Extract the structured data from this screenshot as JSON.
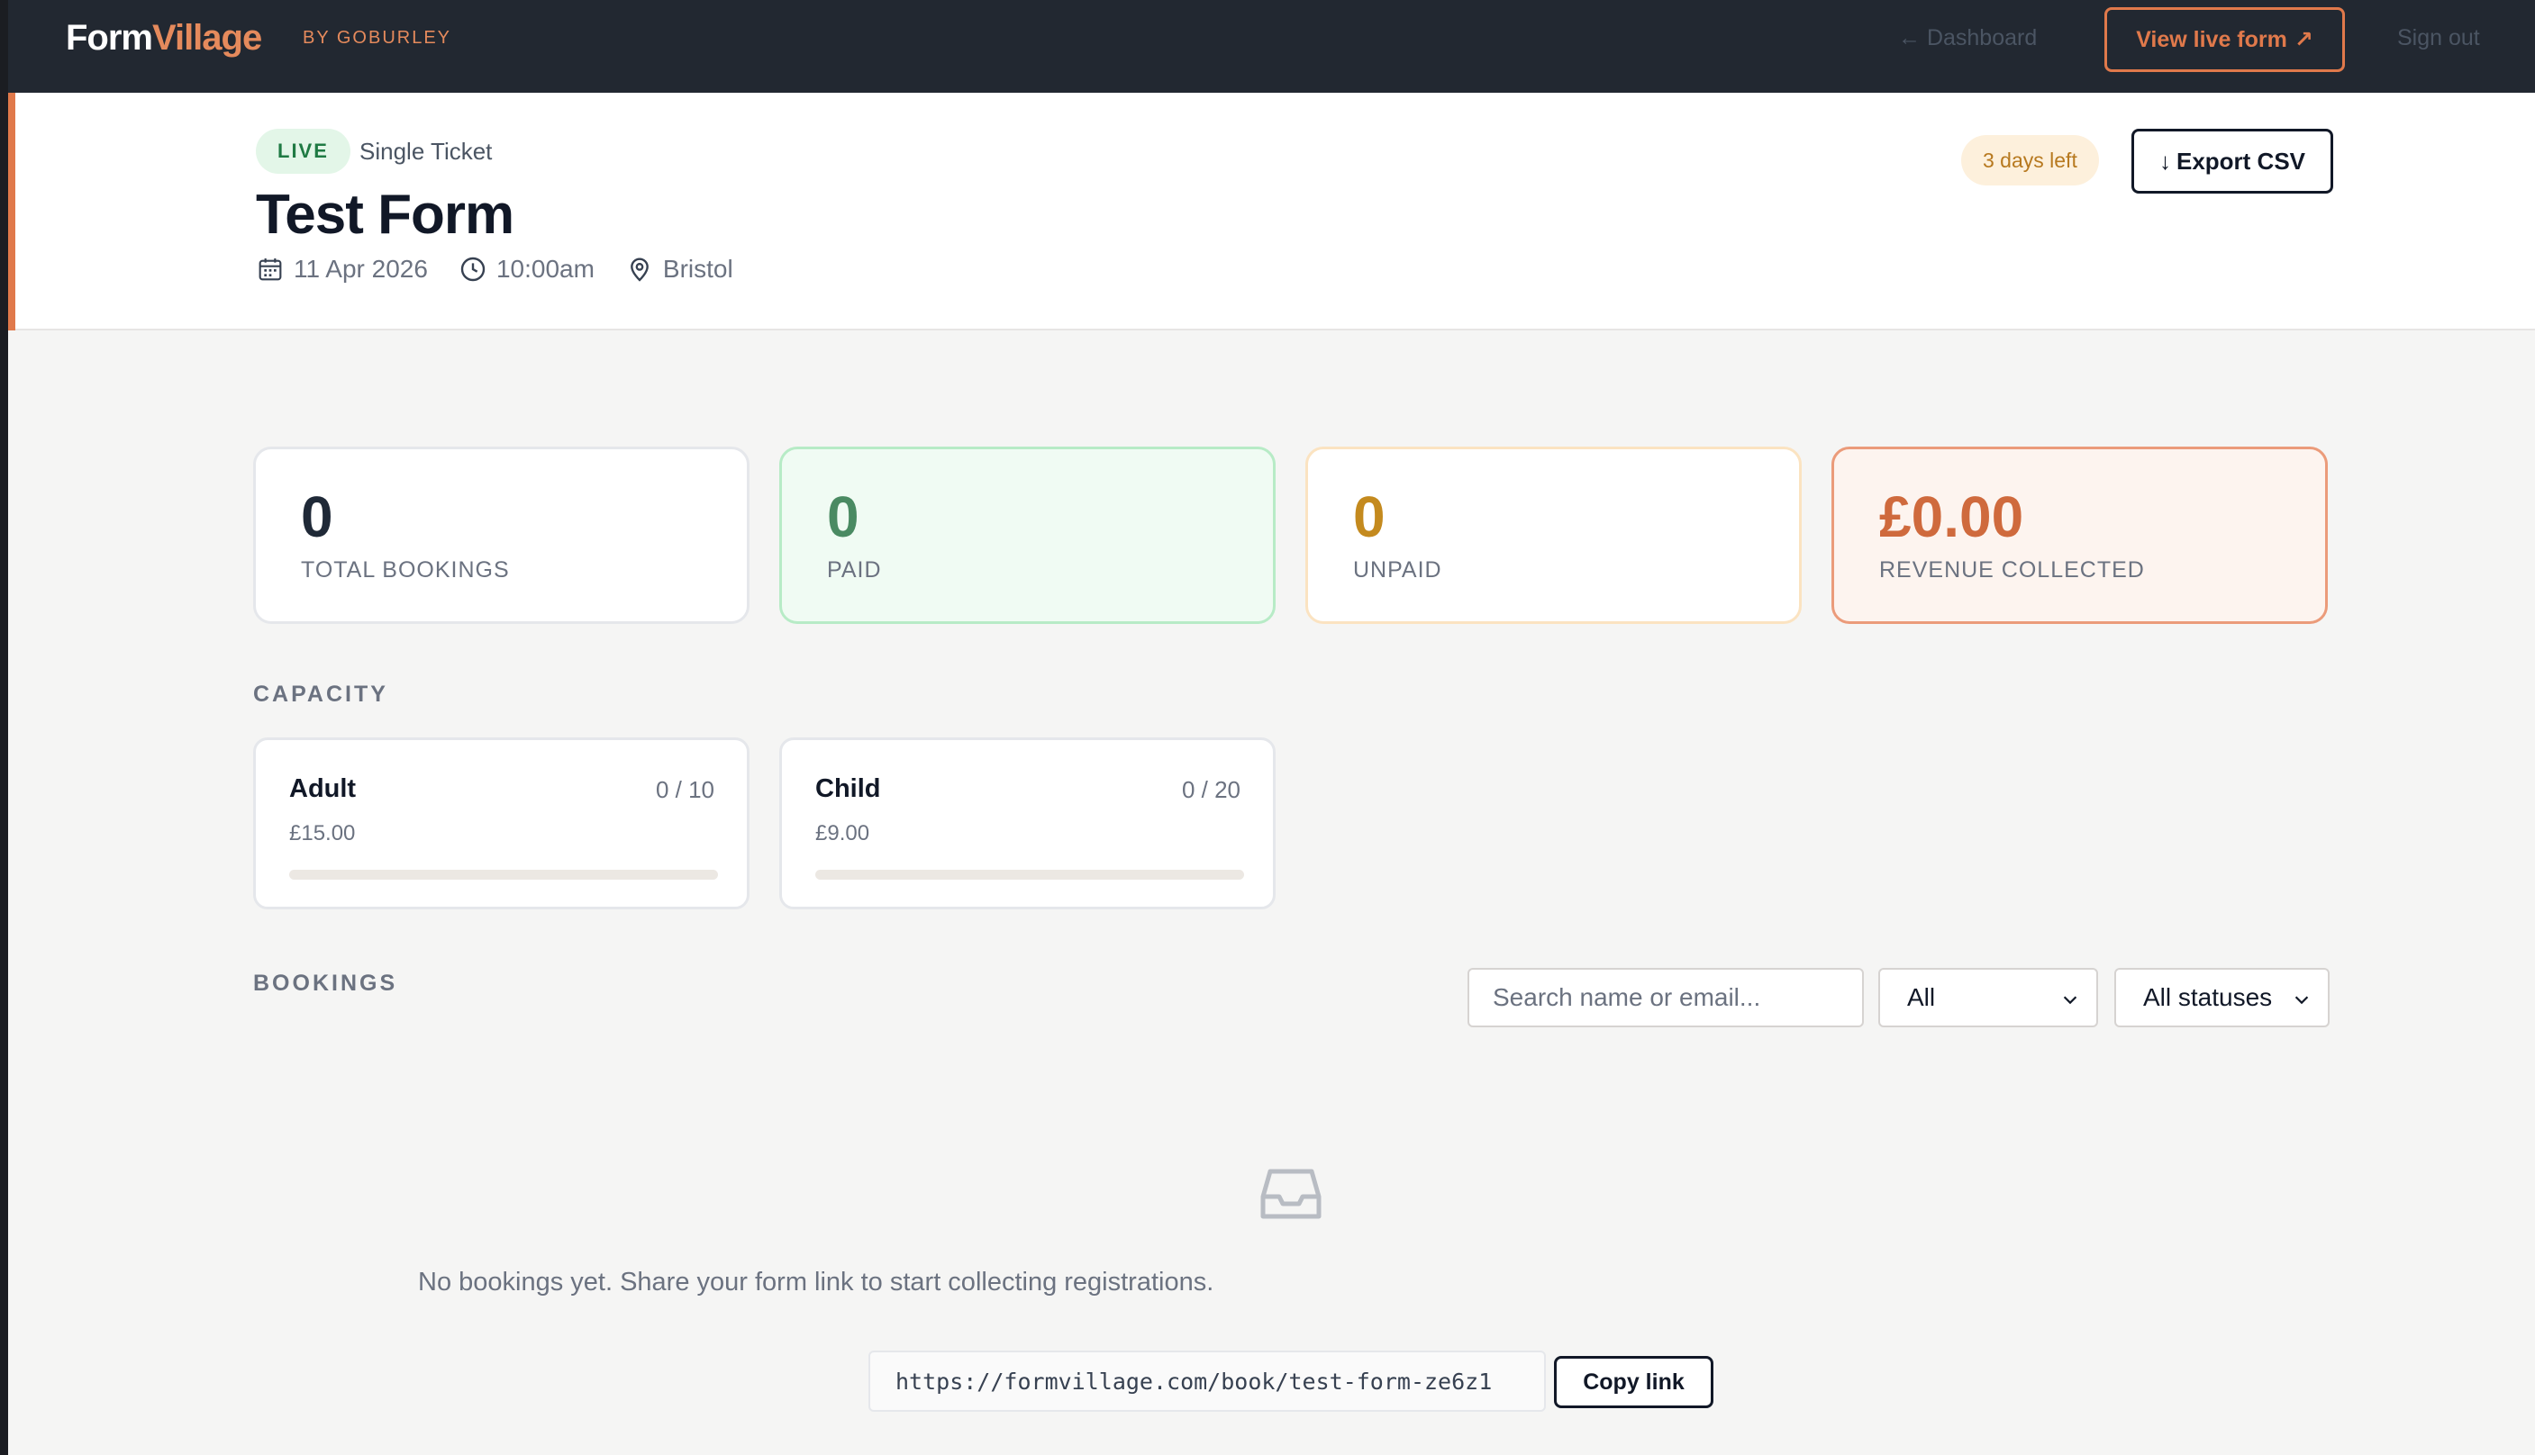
{
  "app": {
    "logo_part1": "Form",
    "logo_part2": "Village",
    "byline": "BY GOBURLEY"
  },
  "nav": {
    "dashboard": "← Dashboard",
    "view_live": "View live form",
    "view_live_icon": "↗",
    "sign_out": "Sign out"
  },
  "form": {
    "status": "LIVE",
    "type": "Single Ticket",
    "title": "Test Form",
    "date": "11 Apr 2026",
    "time": "10:00am",
    "location": "Bristol",
    "days_left": "3 days left",
    "export_label": "Export CSV",
    "export_icon": "↓"
  },
  "stats": {
    "total": {
      "value": "0",
      "label": "TOTAL BOOKINGS"
    },
    "paid": {
      "value": "0",
      "label": "PAID"
    },
    "unpaid": {
      "value": "0",
      "label": "UNPAID"
    },
    "revenue": {
      "value": "£0.00",
      "label": "REVENUE COLLECTED"
    }
  },
  "capacity": {
    "heading": "CAPACITY",
    "items": [
      {
        "name": "Adult",
        "count": "0 / 10",
        "price": "£15.00",
        "fill": 0
      },
      {
        "name": "Child",
        "count": "0 / 20",
        "price": "£9.00",
        "fill": 0
      }
    ]
  },
  "bookings": {
    "heading": "BOOKINGS",
    "search_placeholder": "Search name or email...",
    "type_filter": "All",
    "status_filter": "All statuses",
    "empty_message": "No bookings yet. Share your form link to start collecting registrations.",
    "form_link": "https://formvillage.com/book/test-form-ze6z1",
    "copy_label": "Copy link"
  },
  "colors": {
    "accent": "#e0794b",
    "nav_bg": "#222831",
    "live_green": "#1f7a43"
  }
}
